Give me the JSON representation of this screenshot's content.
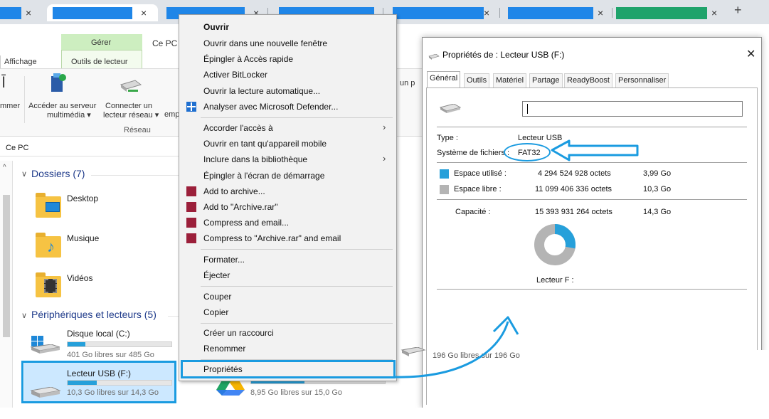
{
  "browser": {
    "tabs": [
      {
        "active": false,
        "close": "×"
      },
      {
        "active": true,
        "close": "×"
      },
      {
        "active": false,
        "close": "×"
      },
      {
        "active": false,
        "close": "×"
      },
      {
        "active": false,
        "close": "×"
      },
      {
        "active": false,
        "close": "×"
      },
      {
        "active": false,
        "close": "×"
      }
    ],
    "new_tab": "+"
  },
  "ribbon": {
    "context_tab_group": "Gérer",
    "tab_ce_pc": "Ce PC",
    "tab_affichage": "Affichage",
    "tab_outils": "Outils de lecteur",
    "btn_access_server": "Accéder au serveur",
    "btn_access_server_sub": "multimédia ▾",
    "btn_map_drive": "Connecter un",
    "btn_map_drive_sub": "lecteur réseau ▾",
    "btn_truncated_left": "mmer",
    "btn_truncated_mid": "emp",
    "group_reseau": "Réseau",
    "right_fragment": "un p"
  },
  "address": {
    "path": "Ce PC"
  },
  "content": {
    "folders_header": "Dossiers (7)",
    "folders": [
      "Desktop",
      "Musique",
      "Vidéos"
    ],
    "drives_header": "Périphériques et lecteurs (5)",
    "drives": [
      {
        "name": "Disque local (C:)",
        "free": "401 Go libres sur 485 Go",
        "used_fraction": 0.17
      },
      {
        "name": "Lecteur USB (F:)",
        "free": "10,3 Go libres sur 14,3 Go",
        "used_fraction": 0.28
      },
      {
        "name": "",
        "free": "8,95 Go libres sur 15,0 Go",
        "used_fraction": 0.4
      },
      {
        "name": "",
        "free": "196 Go libres sur 196 Go",
        "used_fraction": 0.0
      }
    ]
  },
  "context_menu": {
    "items": [
      "Ouvrir",
      "Ouvrir dans une nouvelle fenêtre",
      "Épingler à Accès rapide",
      "Activer BitLocker",
      "Ouvrir la lecture automatique...",
      "Analyser avec Microsoft Defender...",
      "Accorder l'accès à",
      "Ouvrir en tant qu'appareil mobile",
      "Inclure dans la bibliothèque",
      "Épingler à l'écran de démarrage",
      "Add to archive...",
      "Add to \"Archive.rar\"",
      "Compress and email...",
      "Compress to \"Archive.rar\" and email",
      "Formater...",
      "Éjecter",
      "Couper",
      "Copier",
      "Créer un raccourci",
      "Renommer",
      "Propriétés"
    ],
    "submenu_arrow": "›"
  },
  "dialog": {
    "title": "Propriétés de : Lecteur USB (F:)",
    "close": "✕",
    "tabs": [
      "Général",
      "Outils",
      "Matériel",
      "Partage",
      "ReadyBoost",
      "Personnaliser"
    ],
    "volume_name_value": "",
    "type_label": "Type :",
    "type_value": "Lecteur USB",
    "fs_label": "Système de fichiers :",
    "fs_value": "FAT32",
    "used_label": "Espace utilisé :",
    "used_bytes": "4 294 524 928 octets",
    "used_gb": "3,99 Go",
    "free_label": "Espace libre :",
    "free_bytes": "11 099 406 336 octets",
    "free_gb": "10,3 Go",
    "capacity_label": "Capacité :",
    "capacity_bytes": "15 393 931 264 octets",
    "capacity_gb": "14,3 Go",
    "drive_caption": "Lecteur F :",
    "used_fraction": 0.279,
    "colors": {
      "used": "#26a0da",
      "free": "#b4b4b4"
    }
  },
  "annotations": {
    "color": "#1a9be0"
  }
}
